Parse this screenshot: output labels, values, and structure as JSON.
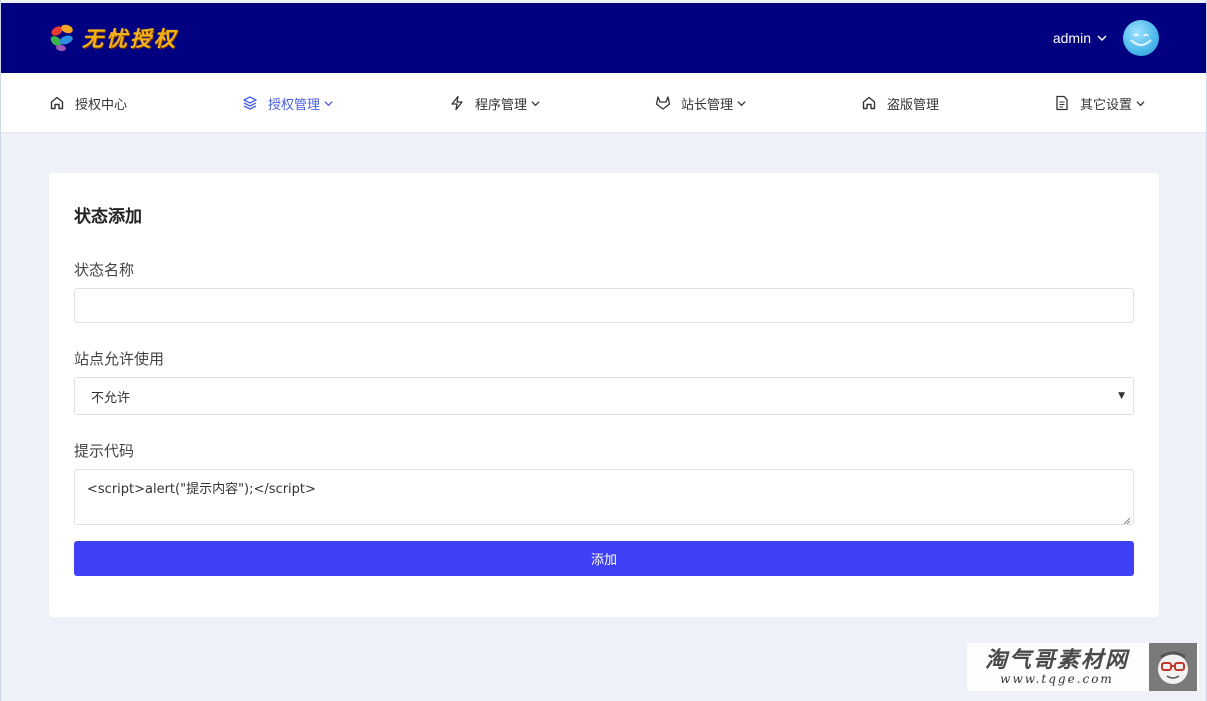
{
  "header": {
    "brand": "无忧授权",
    "user": "admin"
  },
  "nav": {
    "items": [
      {
        "label": "授权中心",
        "icon": "home-icon",
        "dropdown": false
      },
      {
        "label": "授权管理",
        "icon": "layers-icon",
        "dropdown": true,
        "active": true
      },
      {
        "label": "程序管理",
        "icon": "bolt-icon",
        "dropdown": true
      },
      {
        "label": "站长管理",
        "icon": "gitlab-icon",
        "dropdown": true
      },
      {
        "label": "盗版管理",
        "icon": "home-icon",
        "dropdown": false
      },
      {
        "label": "其它设置",
        "icon": "document-icon",
        "dropdown": true
      }
    ]
  },
  "form": {
    "title": "状态添加",
    "name_label": "状态名称",
    "name_value": "",
    "allow_label": "站点允许使用",
    "allow_value": "不允许",
    "code_label": "提示代码",
    "code_value": "<script>alert(\"提示内容\");</script>",
    "submit_label": "添加"
  },
  "watermark": {
    "text": "淘气哥素材网",
    "url": "www.tqge.com"
  },
  "colors": {
    "header_bg": "#000080",
    "accent": "#3f40f5",
    "active_nav": "#4a5ee6",
    "page_bg": "#eef2f8"
  }
}
